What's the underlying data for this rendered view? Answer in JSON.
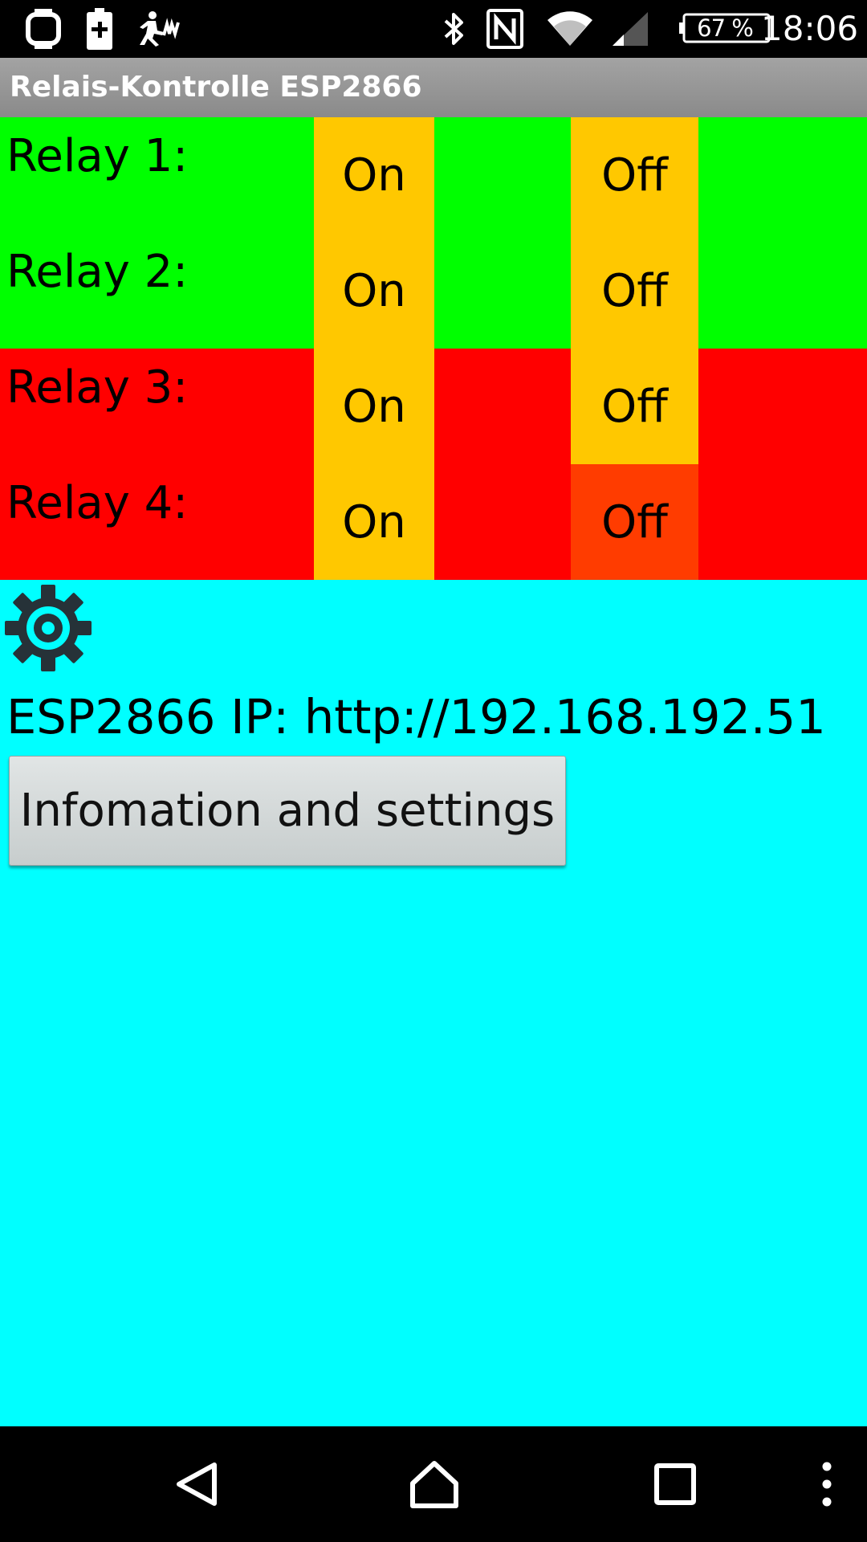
{
  "status_bar": {
    "battery_percent": "67 %",
    "time": "18:06",
    "left_icons": [
      "smartwatch-icon",
      "battery-saver-icon",
      "activity-run-icon"
    ],
    "right_icons": [
      "bluetooth-icon",
      "nfc-icon",
      "wifi-icon",
      "cell-signal-icon",
      "battery-icon"
    ]
  },
  "app_bar": {
    "title": "Relais-Kontrolle ESP2866"
  },
  "relays": [
    {
      "label": "Relay 1:",
      "on_label": "On",
      "off_label": "Off",
      "row_color": "#00ff00",
      "on_color": "#ffc800",
      "off_color": "#ffc800"
    },
    {
      "label": "Relay 2:",
      "on_label": "On",
      "off_label": "Off",
      "row_color": "#00ff00",
      "on_color": "#ffc800",
      "off_color": "#ffc800"
    },
    {
      "label": "Relay 3:",
      "on_label": "On",
      "off_label": "Off",
      "row_color": "#ff0000",
      "on_color": "#ffc800",
      "off_color": "#ffc800"
    },
    {
      "label": "Relay 4:",
      "on_label": "On",
      "off_label": "Off",
      "row_color": "#ff0000",
      "on_color": "#ffc800",
      "off_color": "#ff3c00"
    }
  ],
  "settings": {
    "icon": "gear-icon",
    "ip_text": "ESP2866 IP: http://192.168.192.51",
    "info_button_label": "Infomation and settings"
  },
  "colors": {
    "background": "#00ffff",
    "app_bar": "#969696",
    "gear": "#263238"
  },
  "nav_bar": {
    "icons": [
      "back-icon",
      "home-icon",
      "recents-icon",
      "overflow-menu-icon"
    ]
  }
}
